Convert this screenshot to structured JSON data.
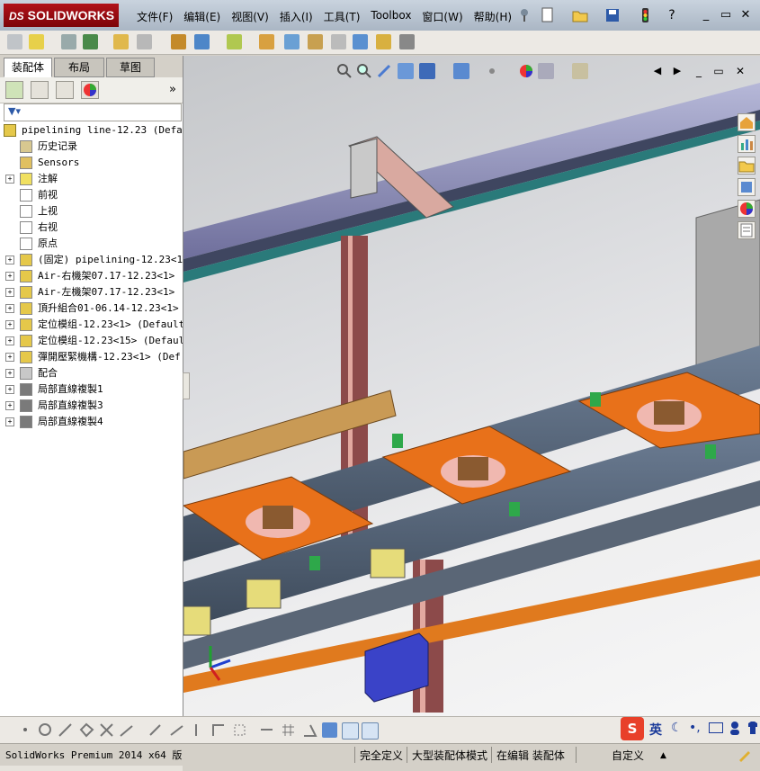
{
  "app": {
    "brand": "SOLIDWORKS",
    "brand_prefix": "DS"
  },
  "menu": [
    "文件(F)",
    "编辑(E)",
    "视图(V)",
    "插入(I)",
    "工具(T)",
    "Toolbox",
    "窗口(W)",
    "帮助(H)"
  ],
  "help_glyph": "?",
  "tabs": [
    "装配体",
    "布局",
    "草图"
  ],
  "tree": {
    "root": "pipelining line-12.23  (Defaul",
    "items": [
      {
        "label": "历史记录",
        "icon": "history-icon",
        "expand": ""
      },
      {
        "label": "Sensors",
        "icon": "sensor-icon",
        "expand": ""
      },
      {
        "label": "注解",
        "icon": "annotation-icon",
        "expand": "+"
      },
      {
        "label": "前视",
        "icon": "plane-icon",
        "expand": ""
      },
      {
        "label": "上视",
        "icon": "plane-icon",
        "expand": ""
      },
      {
        "label": "右视",
        "icon": "plane-icon",
        "expand": ""
      },
      {
        "label": "原点",
        "icon": "origin-icon",
        "expand": ""
      },
      {
        "label": "(固定) pipelining-12.23<1>",
        "icon": "assembly-icon",
        "expand": "+"
      },
      {
        "label": "Air-右機架07.17-12.23<1>  (",
        "icon": "assembly-icon",
        "expand": "+"
      },
      {
        "label": "Air-左機架07.17-12.23<1>  (",
        "icon": "assembly-icon",
        "expand": "+"
      },
      {
        "label": "頂升組合01-06.14-12.23<1>",
        "icon": "assembly-icon",
        "expand": "+"
      },
      {
        "label": "定位模组-12.23<1>  (Default",
        "icon": "assembly-icon",
        "expand": "+"
      },
      {
        "label": "定位模组-12.23<15>  (Defaul",
        "icon": "assembly-icon",
        "expand": "+"
      },
      {
        "label": "彈開壓緊機構-12.23<1>  (Def",
        "icon": "assembly-icon",
        "expand": "+"
      },
      {
        "label": "配合",
        "icon": "mate-icon",
        "expand": "+"
      },
      {
        "label": "局部直線複製1",
        "icon": "pattern-icon",
        "expand": "+"
      },
      {
        "label": "局部直線複製3",
        "icon": "pattern-icon",
        "expand": "+"
      },
      {
        "label": "局部直線複製4",
        "icon": "pattern-icon",
        "expand": "+"
      }
    ]
  },
  "status": {
    "version": "SolidWorks Premium 2014 x64 版",
    "defined": "完全定义",
    "mode": "大型装配体模式",
    "editing": "在编辑 装配体",
    "units": "自定义",
    "arrow": "▲"
  },
  "ime": {
    "label": "英"
  },
  "colors": {
    "accent": "#b1121a",
    "plate": "#e8711a",
    "rail": "#6e7f96"
  }
}
